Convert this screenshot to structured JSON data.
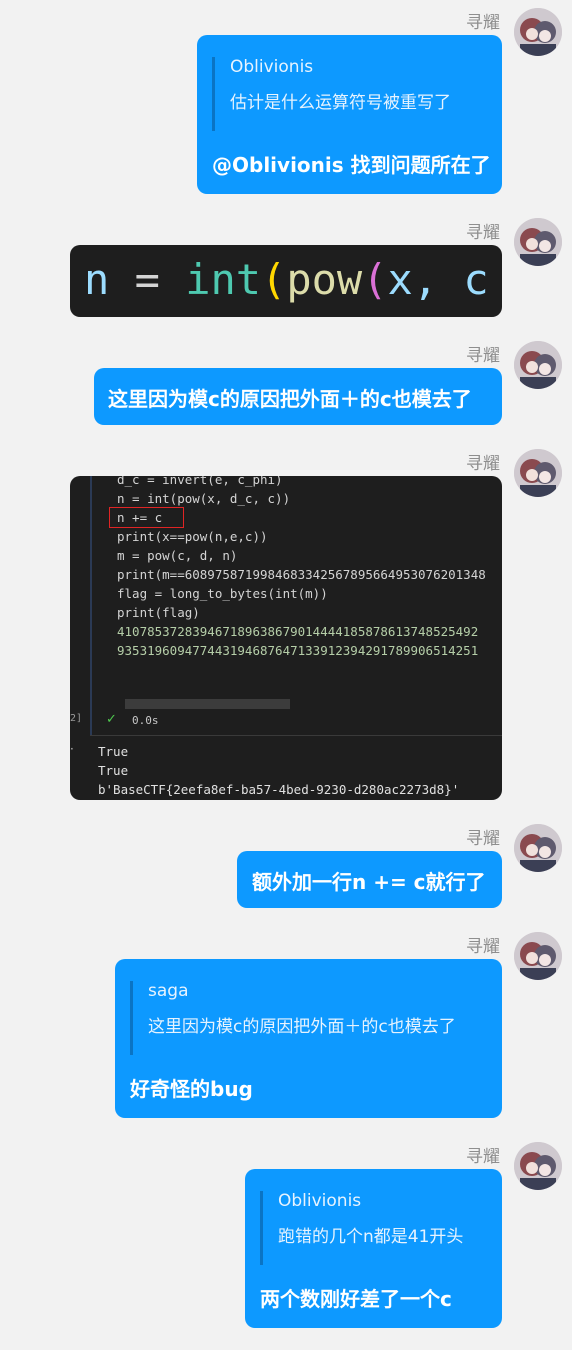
{
  "sender_name": "寻耀",
  "messages": [
    {
      "quote_name": "Oblivionis",
      "quote_text": "估计是什么运算符号被重写了",
      "text": "@Oblivionis 找到问题所在了"
    },
    {
      "code_snippet": {
        "n": "n",
        "eq": "=",
        "int": "int",
        "pow": "pow",
        "args": "x, "
      }
    },
    {
      "text": "这里因为模c的原因把外面＋的c也模去了"
    },
    {
      "code_screenshot": {
        "lines": [
          "d_c = invert(e, c_phi)",
          "n = int(pow(x, d_c, c))",
          "n += c",
          "print(x==pow(n,e,c))",
          "",
          "m = pow(c, d, n)",
          "print(m==6089758719984683342567895664953076201348",
          "flag = long_to_bytes(int(m))",
          "print(flag)",
          "",
          "410785372839467189638679014444185878613748525492",
          "935319609477443194687647133912394291789906514251"
        ],
        "cell_label": "2]",
        "exec_time": "0.0s",
        "output": [
          "True",
          "True",
          "b'BaseCTF{2eefa8ef-ba57-4bed-9230-d280ac2273d8}'"
        ]
      }
    },
    {
      "text": "额外加一行n += c就行了"
    },
    {
      "quote_name": "saga",
      "quote_text": "这里因为模c的原因把外面＋的c也模去了",
      "text": "好奇怪的bug"
    },
    {
      "quote_name": "Oblivionis",
      "quote_text": "跑错的几个n都是41开头",
      "text": "两个数刚好差了一个c"
    }
  ],
  "colors": {
    "bubble": "#0d99ff",
    "background": "#f2f2f2",
    "sender": "#8e8e8e"
  }
}
